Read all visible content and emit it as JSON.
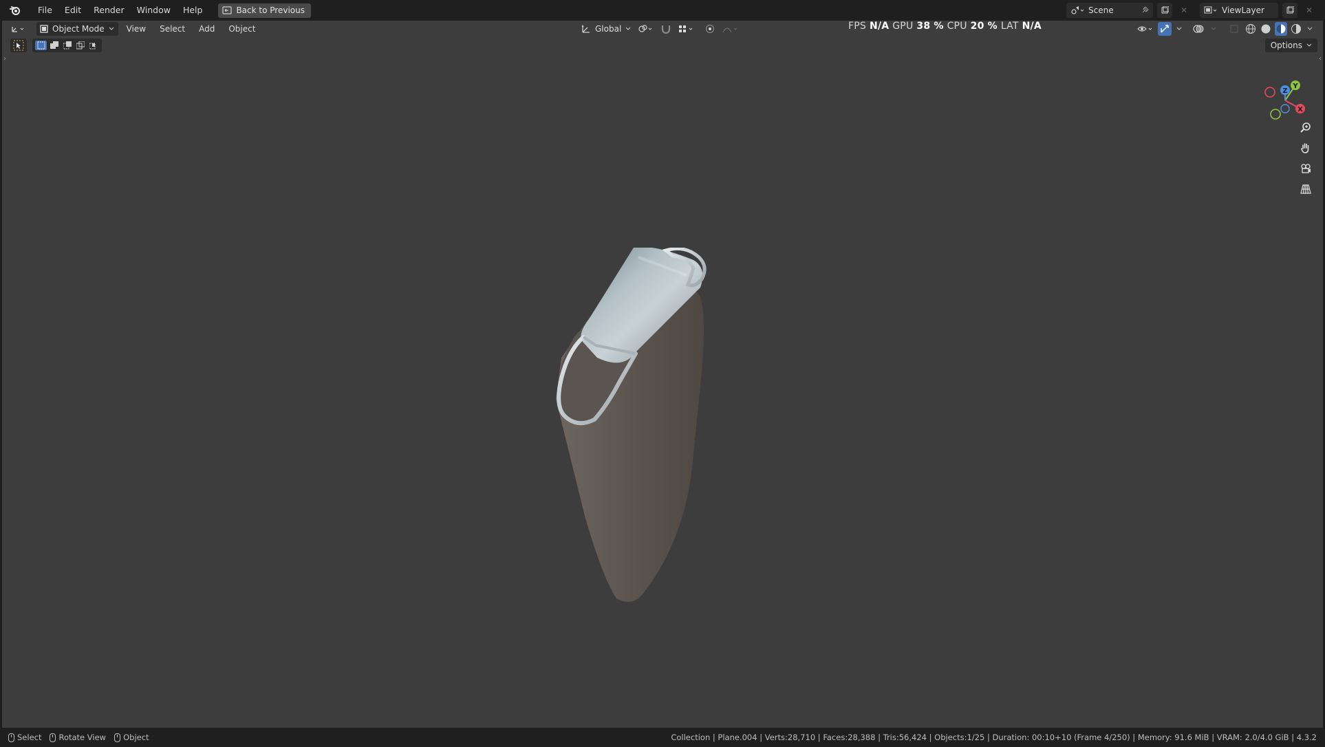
{
  "topbar": {
    "menus": [
      "File",
      "Edit",
      "Render",
      "Window",
      "Help"
    ],
    "back_button": "Back to Previous",
    "scene": "Scene",
    "view_layer": "ViewLayer"
  },
  "viewport_header": {
    "mode": "Object Mode",
    "menus": [
      "View",
      "Select",
      "Add",
      "Object"
    ],
    "transform_orientation": "Global",
    "perf": {
      "fps_label": "FPS",
      "fps_value": "N/A",
      "gpu_label": "GPU",
      "gpu_value": "38 %",
      "cpu_label": "CPU",
      "cpu_value": "20 %",
      "lat_label": "LAT",
      "lat_value": "N/A"
    },
    "options": "Options"
  },
  "gizmo": {
    "y": "Y",
    "z": "Z",
    "x": "X"
  },
  "statusbar": {
    "hints": [
      "Select",
      "Rotate View",
      "Object"
    ],
    "stats": "Collection | Plane.004 | Verts:28,710 | Faces:28,388 | Tris:56,424 | Objects:1/25 | Duration: 00:10+10 (Frame 4/250) | Memory: 91.6 MiB | VRAM: 2.0/4.0 GiB | 4.3.2"
  },
  "colors": {
    "viewport_bg": "#3d3d3d",
    "chrome_bg": "#1f1f1f",
    "accent_blue": "#4772b3",
    "axis_x": "#e44a5e",
    "axis_y": "#8ec63f",
    "axis_z": "#4d8fe6"
  }
}
